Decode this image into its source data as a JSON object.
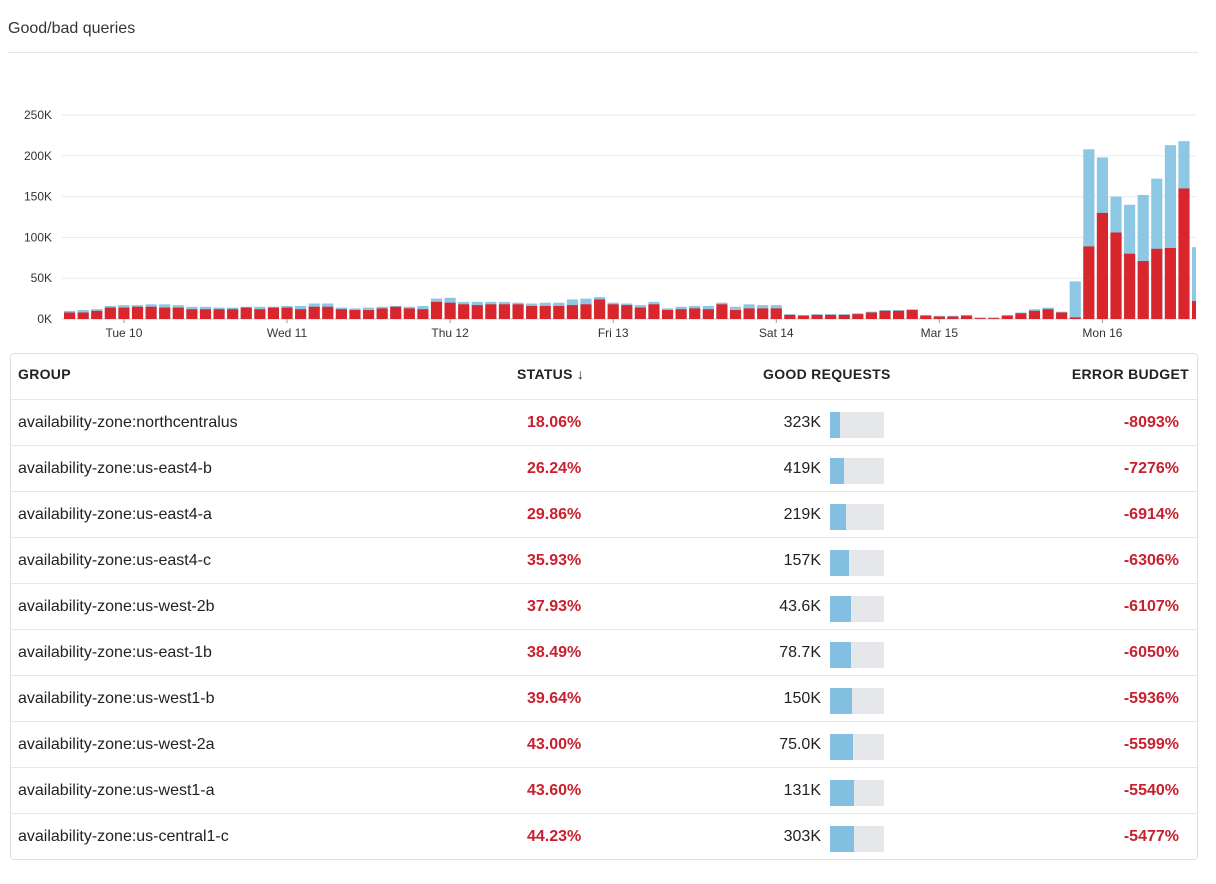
{
  "widget": {
    "title": "Good/bad queries"
  },
  "chart_data": {
    "type": "bar",
    "stacked": true,
    "ylim": [
      0,
      250000
    ],
    "y_ticks": [
      {
        "value": 0,
        "label": "0K"
      },
      {
        "value": 50000,
        "label": "50K"
      },
      {
        "value": 100000,
        "label": "100K"
      },
      {
        "value": 150000,
        "label": "150K"
      },
      {
        "value": 200000,
        "label": "200K"
      },
      {
        "value": 250000,
        "label": "250K"
      }
    ],
    "x_ticks": [
      {
        "bar": 4,
        "label": "Tue 10"
      },
      {
        "bar": 16,
        "label": "Wed 11"
      },
      {
        "bar": 28,
        "label": "Thu 12"
      },
      {
        "bar": 40,
        "label": "Fri 13"
      },
      {
        "bar": 52,
        "label": "Sat 14"
      },
      {
        "bar": 64,
        "label": "Mar 15"
      },
      {
        "bar": 76,
        "label": "Mon 16"
      }
    ],
    "grid": true,
    "colors": {
      "good": "#8cc7e4",
      "bad": "#d9262d"
    },
    "series": [
      {
        "values": [
          10000,
          11000,
          12000,
          16000,
          17000,
          17000,
          18000,
          18000,
          17000,
          15000,
          15000,
          14000,
          14000,
          15000,
          15000,
          15000,
          16000,
          16000,
          19000,
          19000,
          14000,
          13000,
          14000,
          15000,
          16000,
          15000,
          16000,
          25000,
          26000,
          21000,
          21000,
          21000,
          21000,
          20000,
          19000,
          20000,
          20000,
          24000,
          25000,
          27000,
          20000,
          19000,
          17000,
          21000,
          13000,
          15000,
          16000,
          16000,
          20000,
          15000,
          18000,
          17000,
          17000,
          6000,
          5000,
          6000,
          6000,
          6000,
          7000,
          9000,
          11000,
          11000,
          12000,
          5000,
          4000,
          4000,
          5000,
          2000,
          2000,
          5000,
          8000,
          12000,
          14000,
          9000,
          46000,
          208000,
          198000,
          150000,
          140000,
          152000,
          172000,
          213000,
          218000,
          88000
        ]
      },
      {
        "values": [
          8000,
          8000,
          10000,
          14000,
          14000,
          15000,
          15000,
          14000,
          14000,
          12000,
          12000,
          12000,
          12000,
          14000,
          12000,
          14000,
          14000,
          12000,
          15000,
          15000,
          12000,
          11000,
          11000,
          13000,
          15000,
          13000,
          12000,
          21000,
          20000,
          18000,
          17000,
          18000,
          18000,
          18000,
          16000,
          16000,
          16000,
          17000,
          18000,
          24000,
          18000,
          17000,
          14000,
          18000,
          11000,
          12000,
          13000,
          12000,
          18000,
          11000,
          13000,
          13000,
          13000,
          5000,
          4000,
          5000,
          5000,
          5000,
          6000,
          8000,
          10000,
          10000,
          11000,
          4000,
          3000,
          3000,
          4000,
          1000,
          1000,
          4000,
          7000,
          10000,
          12000,
          8000,
          2000,
          89000,
          130000,
          106000,
          80000,
          71000,
          86000,
          87000,
          160000,
          22000
        ]
      }
    ]
  },
  "table": {
    "headers": {
      "group": "GROUP",
      "status": "STATUS ↓",
      "good": "GOOD REQUESTS",
      "err": "ERROR BUDGET"
    },
    "rows": [
      {
        "group": "availability-zone:northcentralus",
        "status": "18.06%",
        "good": "323K",
        "fill": 0.18,
        "err": "-8093%"
      },
      {
        "group": "availability-zone:us-east4-b",
        "status": "26.24%",
        "good": "419K",
        "fill": 0.26,
        "err": "-7276%"
      },
      {
        "group": "availability-zone:us-east4-a",
        "status": "29.86%",
        "good": "219K",
        "fill": 0.3,
        "err": "-6914%"
      },
      {
        "group": "availability-zone:us-east4-c",
        "status": "35.93%",
        "good": "157K",
        "fill": 0.36,
        "err": "-6306%"
      },
      {
        "group": "availability-zone:us-west-2b",
        "status": "37.93%",
        "good": "43.6K",
        "fill": 0.38,
        "err": "-6107%"
      },
      {
        "group": "availability-zone:us-east-1b",
        "status": "38.49%",
        "good": "78.7K",
        "fill": 0.38,
        "err": "-6050%"
      },
      {
        "group": "availability-zone:us-west1-b",
        "status": "39.64%",
        "good": "150K",
        "fill": 0.4,
        "err": "-5936%"
      },
      {
        "group": "availability-zone:us-west-2a",
        "status": "43.00%",
        "good": "75.0K",
        "fill": 0.43,
        "err": "-5599%"
      },
      {
        "group": "availability-zone:us-west1-a",
        "status": "43.60%",
        "good": "131K",
        "fill": 0.44,
        "err": "-5540%"
      },
      {
        "group": "availability-zone:us-central1-c",
        "status": "44.23%",
        "good": "303K",
        "fill": 0.44,
        "err": "-5477%"
      }
    ]
  }
}
